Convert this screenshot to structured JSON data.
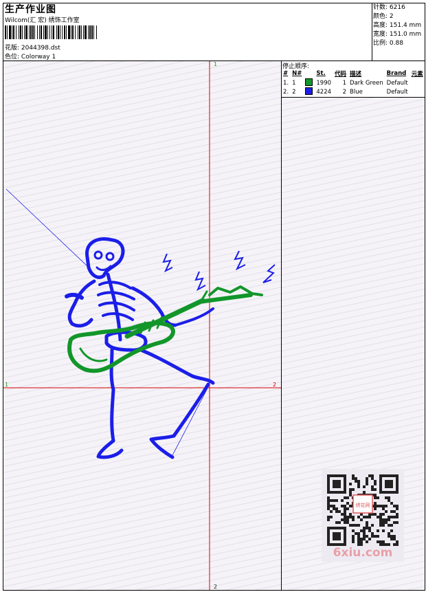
{
  "header": {
    "title": "生产作业图",
    "subtitle": "Wilcom(汇 宏) 绣饰工作室",
    "design_label": "花版:",
    "design_value": "2044398.dst",
    "colorway_label": "色位:",
    "colorway_value": "Colorway 1"
  },
  "stats": [
    {
      "label": "针数:",
      "value": "6216"
    },
    {
      "label": "颜色:",
      "value": "2"
    },
    {
      "label": "高度:",
      "value": "151.4 mm"
    },
    {
      "label": "宽度:",
      "value": "151.0 mm"
    },
    {
      "label": "比例:",
      "value": "0.88"
    }
  ],
  "stop_sequence": {
    "title": "停止顺序:",
    "headers": {
      "idx": "#",
      "n": "N#",
      "st": "St.",
      "code": "代码",
      "desc": "描述",
      "brand": "Brand",
      "element": "元素"
    },
    "rows": [
      {
        "idx": "1.",
        "n": "1",
        "color": "#12962a",
        "st": "1990",
        "code": "1",
        "desc": "Dark Green",
        "brand": "Default"
      },
      {
        "idx": "2.",
        "n": "2",
        "color": "#1b1ee8",
        "st": "4224",
        "code": "2",
        "desc": "Blue",
        "brand": "Default"
      }
    ]
  },
  "axes": {
    "top": "1",
    "bottom": "2",
    "left": "1",
    "right": "2"
  },
  "colors": {
    "thread_green": "#12962a",
    "thread_blue": "#1b1ee8",
    "axis_red": "#d40000"
  },
  "watermark": {
    "brand": "6xiu.com",
    "stamp": "绣花网"
  }
}
